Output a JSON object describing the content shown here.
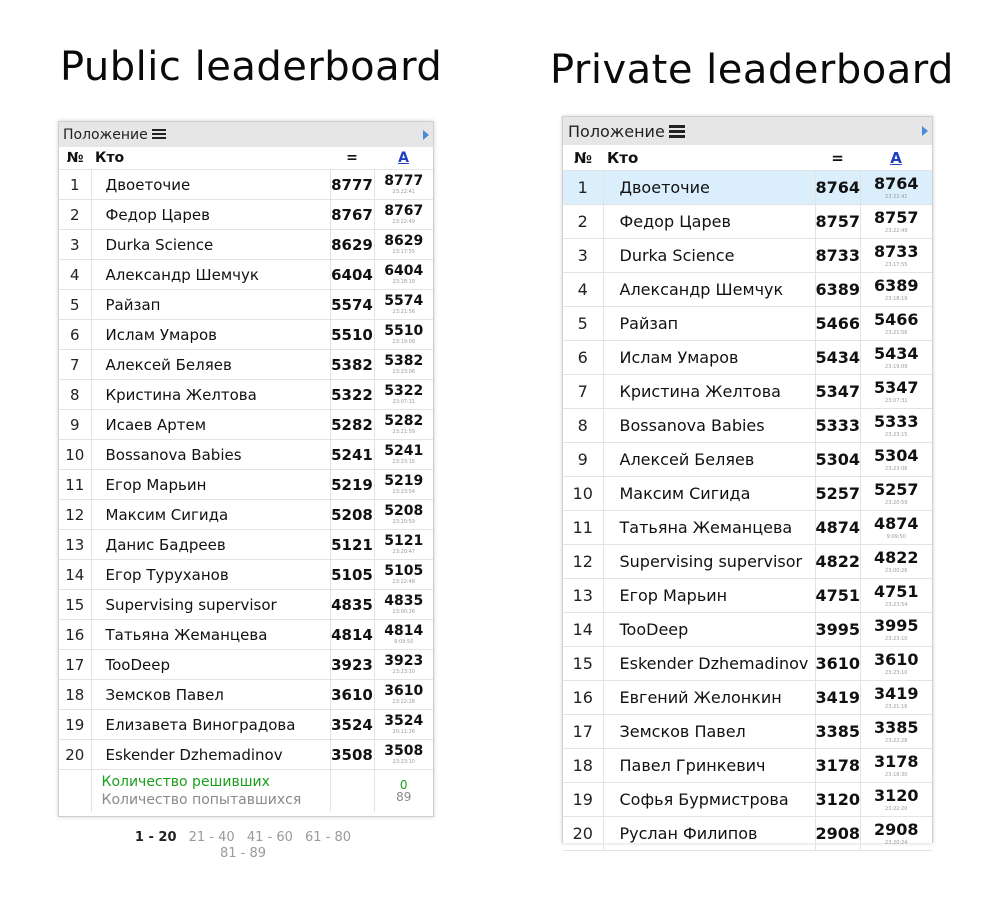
{
  "public": {
    "heading": "Public leaderboard",
    "title": "Положение",
    "columns": {
      "num": "№",
      "who": "Кто",
      "score": "=",
      "problem": "A"
    },
    "rows": [
      {
        "num": "1",
        "name": "Двоеточие",
        "score": "8777",
        "prob": "8777",
        "time": "23:22:41"
      },
      {
        "num": "2",
        "name": "Федор Царев",
        "score": "8767",
        "prob": "8767",
        "time": "23:22:49"
      },
      {
        "num": "3",
        "name": "Durka Science",
        "score": "8629",
        "prob": "8629",
        "time": "23:17:55"
      },
      {
        "num": "4",
        "name": "Александр Шемчук",
        "score": "6404",
        "prob": "6404",
        "time": "23:18:19"
      },
      {
        "num": "5",
        "name": "Райзап",
        "score": "5574",
        "prob": "5574",
        "time": "23:21:56"
      },
      {
        "num": "6",
        "name": "Ислам Умаров",
        "score": "5510",
        "prob": "5510",
        "time": "23:19:09"
      },
      {
        "num": "7",
        "name": "Алексей Беляев",
        "score": "5382",
        "prob": "5382",
        "time": "23:23:06"
      },
      {
        "num": "8",
        "name": "Кристина Желтова",
        "score": "5322",
        "prob": "5322",
        "time": "23:07:31"
      },
      {
        "num": "9",
        "name": "Исаев Артем",
        "score": "5282",
        "prob": "5282",
        "time": "23:21:59"
      },
      {
        "num": "10",
        "name": "Bossanova Babies",
        "score": "5241",
        "prob": "5241",
        "time": "23:23:15"
      },
      {
        "num": "11",
        "name": "Егор Марьин",
        "score": "5219",
        "prob": "5219",
        "time": "23:23:54"
      },
      {
        "num": "12",
        "name": "Максим Сигида",
        "score": "5208",
        "prob": "5208",
        "time": "23:20:59"
      },
      {
        "num": "13",
        "name": "Данис Бадреев",
        "score": "5121",
        "prob": "5121",
        "time": "23:20:47"
      },
      {
        "num": "14",
        "name": "Егор Туруханов",
        "score": "5105",
        "prob": "5105",
        "time": "23:22:48"
      },
      {
        "num": "15",
        "name": "Supervising supervisor",
        "score": "4835",
        "prob": "4835",
        "time": "23:00:26"
      },
      {
        "num": "16",
        "name": "Татьяна Жеманцева",
        "score": "4814",
        "prob": "4814",
        "time": "9:09:50"
      },
      {
        "num": "17",
        "name": "TooDeep",
        "score": "3923",
        "prob": "3923",
        "time": "23:23:10"
      },
      {
        "num": "18",
        "name": "Земсков Павел",
        "score": "3610",
        "prob": "3610",
        "time": "23:22:28"
      },
      {
        "num": "19",
        "name": "Елизавета Виноградова",
        "score": "3524",
        "prob": "3524",
        "time": "20:11:26"
      },
      {
        "num": "20",
        "name": "Eskender Dzhemadinov",
        "score": "3508",
        "prob": "3508",
        "time": "23:23:10"
      }
    ],
    "footer": {
      "solved_label": "Количество решивших",
      "tried_label": "Количество попытавшихся",
      "solved_value": "0",
      "tried_value": "89"
    },
    "pager": {
      "pages": [
        "1 - 20",
        "21 - 40",
        "41 - 60",
        "61 - 80",
        "81 - 89"
      ],
      "current": "1 - 20"
    }
  },
  "private": {
    "heading": "Private leaderboard",
    "title": "Положение",
    "columns": {
      "num": "№",
      "who": "Кто",
      "score": "=",
      "problem": "A"
    },
    "rows": [
      {
        "num": "1",
        "name": "Двоеточие",
        "score": "8764",
        "prob": "8764",
        "time": "23:22:41"
      },
      {
        "num": "2",
        "name": "Федор Царев",
        "score": "8757",
        "prob": "8757",
        "time": "23:22:49"
      },
      {
        "num": "3",
        "name": "Durka Science",
        "score": "8733",
        "prob": "8733",
        "time": "23:17:55"
      },
      {
        "num": "4",
        "name": "Александр Шемчук",
        "score": "6389",
        "prob": "6389",
        "time": "23:18:19"
      },
      {
        "num": "5",
        "name": "Райзап",
        "score": "5466",
        "prob": "5466",
        "time": "23:21:56"
      },
      {
        "num": "6",
        "name": "Ислам Умаров",
        "score": "5434",
        "prob": "5434",
        "time": "23:19:09"
      },
      {
        "num": "7",
        "name": "Кристина Желтова",
        "score": "5347",
        "prob": "5347",
        "time": "23:07:31"
      },
      {
        "num": "8",
        "name": "Bossanova Babies",
        "score": "5333",
        "prob": "5333",
        "time": "23:23:15"
      },
      {
        "num": "9",
        "name": "Алексей Беляев",
        "score": "5304",
        "prob": "5304",
        "time": "23:23:06"
      },
      {
        "num": "10",
        "name": "Максим Сигида",
        "score": "5257",
        "prob": "5257",
        "time": "23:20:59"
      },
      {
        "num": "11",
        "name": "Татьяна Жеманцева",
        "score": "4874",
        "prob": "4874",
        "time": "9:09:50"
      },
      {
        "num": "12",
        "name": "Supervising supervisor",
        "score": "4822",
        "prob": "4822",
        "time": "23:00:26"
      },
      {
        "num": "13",
        "name": "Егор Марьин",
        "score": "4751",
        "prob": "4751",
        "time": "23:23:54"
      },
      {
        "num": "14",
        "name": "TooDeep",
        "score": "3995",
        "prob": "3995",
        "time": "23:23:10"
      },
      {
        "num": "15",
        "name": "Eskender Dzhemadinov",
        "score": "3610",
        "prob": "3610",
        "time": "23:23:10"
      },
      {
        "num": "16",
        "name": "Евгений Желонкин",
        "score": "3419",
        "prob": "3419",
        "time": "23:21:16"
      },
      {
        "num": "17",
        "name": "Земсков Павел",
        "score": "3385",
        "prob": "3385",
        "time": "23:22:28"
      },
      {
        "num": "18",
        "name": "Павел Гринкевич",
        "score": "3178",
        "prob": "3178",
        "time": "23:18:30"
      },
      {
        "num": "19",
        "name": "Софья Бурмистрова",
        "score": "3120",
        "prob": "3120",
        "time": "23:22:20"
      },
      {
        "num": "20",
        "name": "Руслан Филипов",
        "score": "2908",
        "prob": "2908",
        "time": "23:20:24"
      }
    ],
    "highlight_row": "1"
  },
  "colors": {
    "header_bg": "#e6e6e6",
    "highlight_bg": "#dbeefc",
    "solved_green": "#1b9e1b",
    "link_blue": "#1f3fbf",
    "arrow_blue": "#4a8ad9"
  },
  "icons": {
    "list": "list-icon",
    "expand": "chevron-right-icon"
  }
}
